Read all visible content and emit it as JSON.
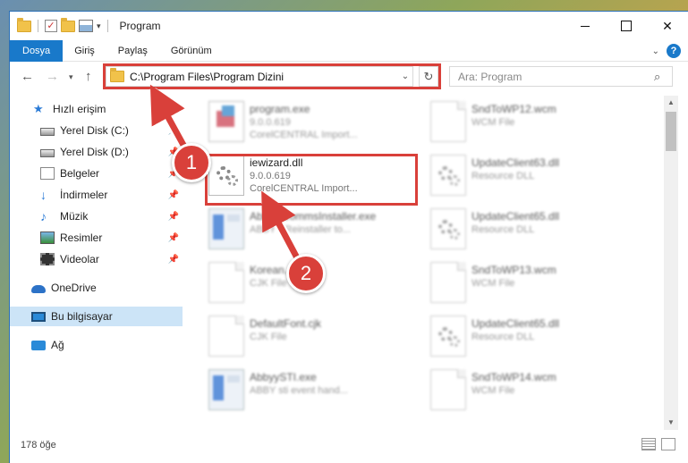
{
  "window": {
    "title": "Program",
    "controls": {
      "minimize": "",
      "maximize": "",
      "close": "✕"
    }
  },
  "ribbon": {
    "tabs": [
      "Dosya",
      "Giriş",
      "Paylaş",
      "Görünüm"
    ],
    "help": "?"
  },
  "address": {
    "path": "C:\\Program Files\\Program Dizini",
    "search_placeholder": "Ara: Program"
  },
  "nav": {
    "items": [
      {
        "label": "Hızlı erişim",
        "icon": "star-icon",
        "pinned": false
      },
      {
        "label": "Yerel Disk (C:)",
        "icon": "drive-icon",
        "pinned": true
      },
      {
        "label": "Yerel Disk (D:)",
        "icon": "drive-icon",
        "pinned": true
      },
      {
        "label": "Belgeler",
        "icon": "documents-icon",
        "pinned": true
      },
      {
        "label": "İndirmeler",
        "icon": "downloads-icon",
        "pinned": true
      },
      {
        "label": "Müzik",
        "icon": "music-icon",
        "pinned": true
      },
      {
        "label": "Resimler",
        "icon": "pictures-icon",
        "pinned": true
      },
      {
        "label": "Videolar",
        "icon": "videos-icon",
        "pinned": true
      },
      {
        "label": "OneDrive",
        "icon": "onedrive-icon",
        "pinned": false
      },
      {
        "label": "Bu bilgisayar",
        "icon": "computer-icon",
        "pinned": false,
        "selected": true
      },
      {
        "label": "Ağ",
        "icon": "network-icon",
        "pinned": false
      }
    ]
  },
  "files": [
    {
      "name": "program.exe",
      "line2": "9.0.0.619",
      "line3": "CorelCENTRAL Import...",
      "icon": "program-icon",
      "blurred": true
    },
    {
      "name": "SndToWP12.wcm",
      "line2": "WCM File",
      "line3": "",
      "icon": "blank-file-icon",
      "blurred": true
    },
    {
      "name": "iewizard.dll",
      "line2": "9.0.0.619",
      "line3": "CorelCENTRAL Import...",
      "icon": "dll-gear-icon",
      "blurred": false
    },
    {
      "name": "UpdateClient63.dll",
      "line2": "Resource DLL",
      "line3": "",
      "icon": "dll-gear-icon",
      "blurred": true
    },
    {
      "name": "Abbyy.CommsInstaller.exe",
      "line2": "ABBYY Reinstaller to...",
      "line3": "",
      "icon": "exe-icon",
      "blurred": true
    },
    {
      "name": "UpdateClient65.dll",
      "line2": "Resource DLL",
      "line3": "",
      "icon": "dll-gear-icon",
      "blurred": true
    },
    {
      "name": "Korean...",
      "line2": "CJK File",
      "line3": "",
      "icon": "blank-file-icon",
      "blurred": true
    },
    {
      "name": "SndToWP13.wcm",
      "line2": "WCM File",
      "line3": "",
      "icon": "blank-file-icon",
      "blurred": true
    },
    {
      "name": "DefaultFont.cjk",
      "line2": "CJK File",
      "line3": "",
      "icon": "blank-file-icon",
      "blurred": true
    },
    {
      "name": "UpdateClient65.dll",
      "line2": "Resource DLL",
      "line3": "",
      "icon": "dll-gear-icon",
      "blurred": true
    },
    {
      "name": "AbbyySTI.exe",
      "line2": "ABBY sti event hand...",
      "line3": "",
      "icon": "exe-icon",
      "blurred": true
    },
    {
      "name": "SndToWP14.wcm",
      "line2": "WCM File",
      "line3": "",
      "icon": "blank-file-icon",
      "blurred": true
    }
  ],
  "status": {
    "count": "178 öğe"
  },
  "annotations": {
    "step1": "1",
    "step2": "2",
    "color": "#d9403a"
  }
}
